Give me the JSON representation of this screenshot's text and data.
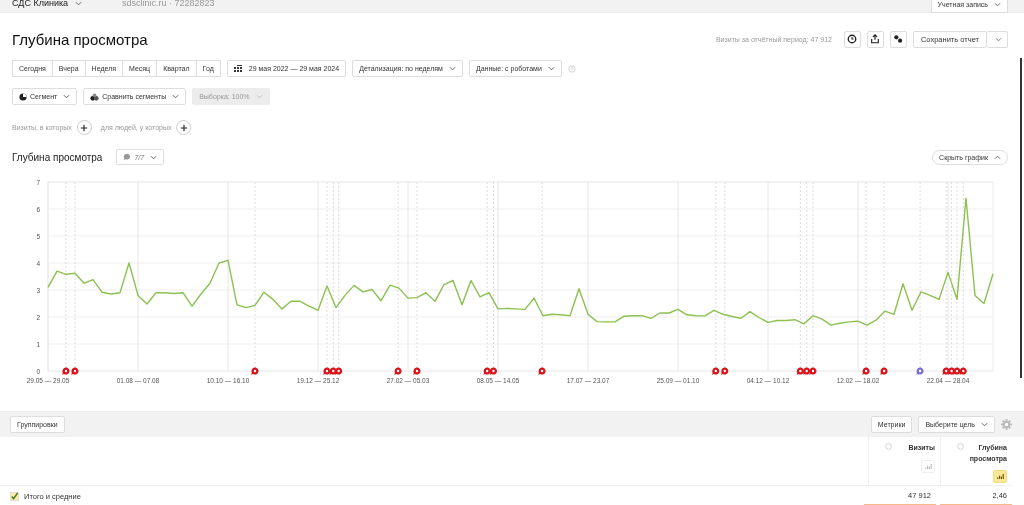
{
  "top_bar": {
    "counter_name": "СДС Клиника",
    "site": "sdsclinic.ru · 72282823",
    "account_button": "Учетная запись"
  },
  "title": "Глубина просмотра",
  "visits_summary": "Визиты за отчётный период: 47 912",
  "save_button": "Сохранить отчет",
  "periods": [
    {
      "label": "Сегодня",
      "selected": false
    },
    {
      "label": "Вчера",
      "selected": false
    },
    {
      "label": "Неделя",
      "selected": false
    },
    {
      "label": "Месяц",
      "selected": false
    },
    {
      "label": "Квартал",
      "selected": false
    },
    {
      "label": "Год",
      "selected": false
    }
  ],
  "date_range": "29 мая 2022 — 29 мая 2024",
  "detail_dropdown": "Детализация: по неделям",
  "data_dropdown": "Данные: с роботами",
  "segment_button": "Сегмент",
  "compare_button": "Сравнить сегменты",
  "sample_button": {
    "label": "Выборка: 100%",
    "disabled": true
  },
  "filters": [
    {
      "label": "Визиты, в которых"
    },
    {
      "label": "для людей, у которых"
    }
  ],
  "chart_header": {
    "series_button": "7/7",
    "hide_button": "Скрыть график"
  },
  "chart": {
    "chart_data": {
      "type": "line",
      "title": "Глубина просмотра",
      "grid": true,
      "ylim": [
        0,
        7
      ],
      "yticks": [
        0,
        1,
        2,
        3,
        4,
        5,
        6,
        7
      ],
      "categories": [
        "29.05 — 29.05",
        null,
        null,
        null,
        null,
        null,
        null,
        null,
        null,
        null,
        "01.08 — 07.08",
        null,
        null,
        null,
        null,
        null,
        null,
        null,
        null,
        null,
        "10.10 — 16.10",
        null,
        null,
        null,
        null,
        null,
        null,
        null,
        null,
        null,
        "19.12 — 25.12",
        null,
        null,
        null,
        null,
        null,
        null,
        null,
        null,
        null,
        "27.02 — 05.03",
        null,
        null,
        null,
        null,
        null,
        null,
        null,
        null,
        null,
        "08.05 — 14.05",
        null,
        null,
        null,
        null,
        null,
        null,
        null,
        null,
        null,
        "17.07 — 23.07",
        null,
        null,
        null,
        null,
        null,
        null,
        null,
        null,
        null,
        "25.09 — 01.10",
        null,
        null,
        null,
        null,
        null,
        null,
        null,
        null,
        null,
        "04.12 — 10.12",
        null,
        null,
        null,
        null,
        null,
        null,
        null,
        null,
        null,
        "12.02 — 18.02",
        null,
        null,
        null,
        null,
        null,
        null,
        null,
        null,
        null,
        "22.04 — 28.04",
        null,
        null,
        null,
        null,
        null
      ],
      "series": [
        {
          "color": "#8cc152",
          "values": [
            3.1,
            3.7,
            3.58,
            3.62,
            3.25,
            3.38,
            2.92,
            2.85,
            2.9,
            4.0,
            2.8,
            2.48,
            2.9,
            2.9,
            2.87,
            2.9,
            2.4,
            2.85,
            3.25,
            4.0,
            4.1,
            2.45,
            2.35,
            2.43,
            2.92,
            2.65,
            2.3,
            2.58,
            2.58,
            2.4,
            2.25,
            3.15,
            2.35,
            2.8,
            3.17,
            2.93,
            3.02,
            2.6,
            3.18,
            3.07,
            2.7,
            2.72,
            2.9,
            2.58,
            3.2,
            3.35,
            2.45,
            3.35,
            2.75,
            2.9,
            2.3,
            2.32,
            2.3,
            2.28,
            2.7,
            2.05,
            2.1,
            2.08,
            2.05,
            3.05,
            2.1,
            1.83,
            1.82,
            1.82,
            2.03,
            2.05,
            2.05,
            1.95,
            2.15,
            2.15,
            2.28,
            2.08,
            2.05,
            2.04,
            2.25,
            2.1,
            2.02,
            1.95,
            2.2,
            1.98,
            1.8,
            1.87,
            1.87,
            1.9,
            1.75,
            2.05,
            1.92,
            1.7,
            1.77,
            1.82,
            1.85,
            1.7,
            1.88,
            2.22,
            2.1,
            3.23,
            2.25,
            2.93,
            2.8,
            2.65,
            3.65,
            2.65,
            6.4,
            2.8,
            2.5,
            3.6
          ]
        }
      ]
    }
  },
  "toolbar": {
    "groupings_button": "Группировки",
    "metrics_button": "Метрики",
    "goal_dropdown": "Выберите цель"
  },
  "table": {
    "columns": [
      {
        "label": "Визиты",
        "selected": false
      },
      {
        "label": "Глубина просмотра",
        "selected": true
      }
    ],
    "rows": [
      {
        "label": "Итого и средние",
        "checked": true,
        "cells": [
          "47 912",
          "2,46"
        ]
      }
    ]
  }
}
